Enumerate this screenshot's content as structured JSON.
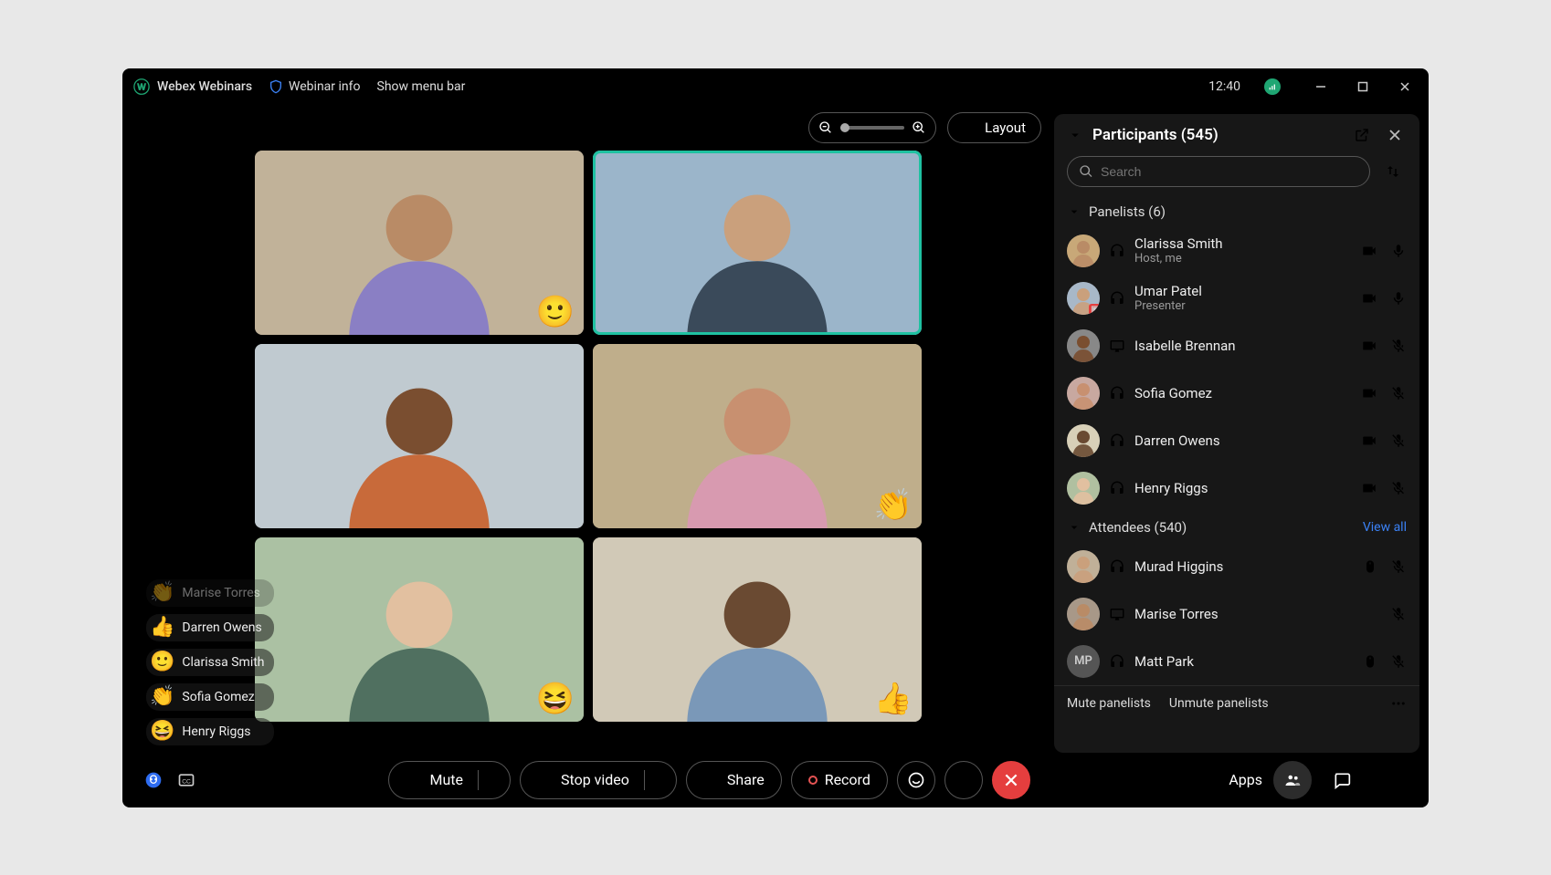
{
  "titlebar": {
    "brand": "Webex Webinars",
    "webinar_info": "Webinar info",
    "show_menu": "Show menu bar",
    "clock": "12:40"
  },
  "stage": {
    "layout_label": "Layout",
    "tiles": [
      {
        "name": "tile-1",
        "reaction": "🙂",
        "active": false,
        "bg1": "#e6d8c0",
        "bg2": "#8a7a60",
        "skin": "#b98b66",
        "shirt": "#8a7fc4"
      },
      {
        "name": "tile-2",
        "reaction": "",
        "active": true,
        "bg1": "#bcd4e6",
        "bg2": "#6a88a0",
        "skin": "#caa07c",
        "shirt": "#3a4a5a"
      },
      {
        "name": "tile-3",
        "reaction": "",
        "active": false,
        "bg1": "#e0e6ea",
        "bg2": "#90a0aa",
        "skin": "#7a4e30",
        "shirt": "#c86a3a"
      },
      {
        "name": "tile-4",
        "reaction": "👏",
        "active": false,
        "bg1": "#d8c8a8",
        "bg2": "#9a8860",
        "skin": "#c89070",
        "shirt": "#d89ab0"
      },
      {
        "name": "tile-5",
        "reaction": "😆",
        "active": false,
        "bg1": "#c8d8c0",
        "bg2": "#80a078",
        "skin": "#e2c0a0",
        "shirt": "#507060"
      },
      {
        "name": "tile-6",
        "reaction": "👍",
        "active": false,
        "bg1": "#e8e0d0",
        "bg2": "#b0a890",
        "skin": "#6a4a32",
        "shirt": "#7a98b8"
      }
    ]
  },
  "reactions_feed": [
    {
      "emoji": "👏",
      "name": "Marise Torres",
      "faded": true
    },
    {
      "emoji": "👍",
      "name": "Darren Owens"
    },
    {
      "emoji": "🙂",
      "name": "Clarissa Smith"
    },
    {
      "emoji": "👏",
      "name": "Sofia Gomez"
    },
    {
      "emoji": "😆",
      "name": "Henry Riggs"
    }
  ],
  "panel": {
    "title": "Participants (545)",
    "search_placeholder": "Search",
    "panelists_header": "Panelists (6)",
    "attendees_header": "Attendees (540)",
    "view_all": "View all",
    "panelists": [
      {
        "name": "Clarissa Smith",
        "role": "Host, me",
        "device": "headset",
        "mic": "on",
        "cam": true,
        "badge": "",
        "bg": "#c8a878",
        "skin": "#b98b66"
      },
      {
        "name": "Umar Patel",
        "role": "Presenter",
        "device": "headset",
        "mic": "on",
        "cam": true,
        "badge": "presenter",
        "bg": "#a8b8c8",
        "skin": "#caa07c"
      },
      {
        "name": "Isabelle Brennan",
        "role": "",
        "device": "computer",
        "mic": "off",
        "cam": true,
        "badge": "",
        "bg": "#888",
        "skin": "#7a4e30"
      },
      {
        "name": "Sofia Gomez",
        "role": "",
        "device": "headset",
        "mic": "off",
        "cam": true,
        "badge": "",
        "bg": "#c8a8a0",
        "skin": "#c89070"
      },
      {
        "name": "Darren Owens",
        "role": "",
        "device": "headset",
        "mic": "off",
        "cam": true,
        "badge": "",
        "bg": "#d8d0b8",
        "skin": "#6a4a32"
      },
      {
        "name": "Henry Riggs",
        "role": "",
        "device": "headset",
        "mic": "off",
        "cam": true,
        "badge": "",
        "bg": "#b0c0a0",
        "skin": "#e2c0a0"
      }
    ],
    "attendees": [
      {
        "name": "Murad Higgins",
        "device": "headset",
        "mic": "off",
        "mouse": true,
        "initials": "",
        "bg": "#c0b098",
        "skin": "#caa07c"
      },
      {
        "name": "Marise Torres",
        "device": "computer",
        "mic": "off",
        "mouse": false,
        "initials": "",
        "bg": "#a89888",
        "skin": "#b98b66"
      },
      {
        "name": "Matt Park",
        "device": "headset",
        "mic": "off",
        "mouse": true,
        "initials": "MP",
        "bg": "#555",
        "skin": ""
      }
    ],
    "footer": {
      "mute": "Mute panelists",
      "unmute": "Unmute panelists"
    }
  },
  "toolbar": {
    "mute": "Mute",
    "stop_video": "Stop video",
    "share": "Share",
    "record": "Record",
    "apps": "Apps"
  }
}
